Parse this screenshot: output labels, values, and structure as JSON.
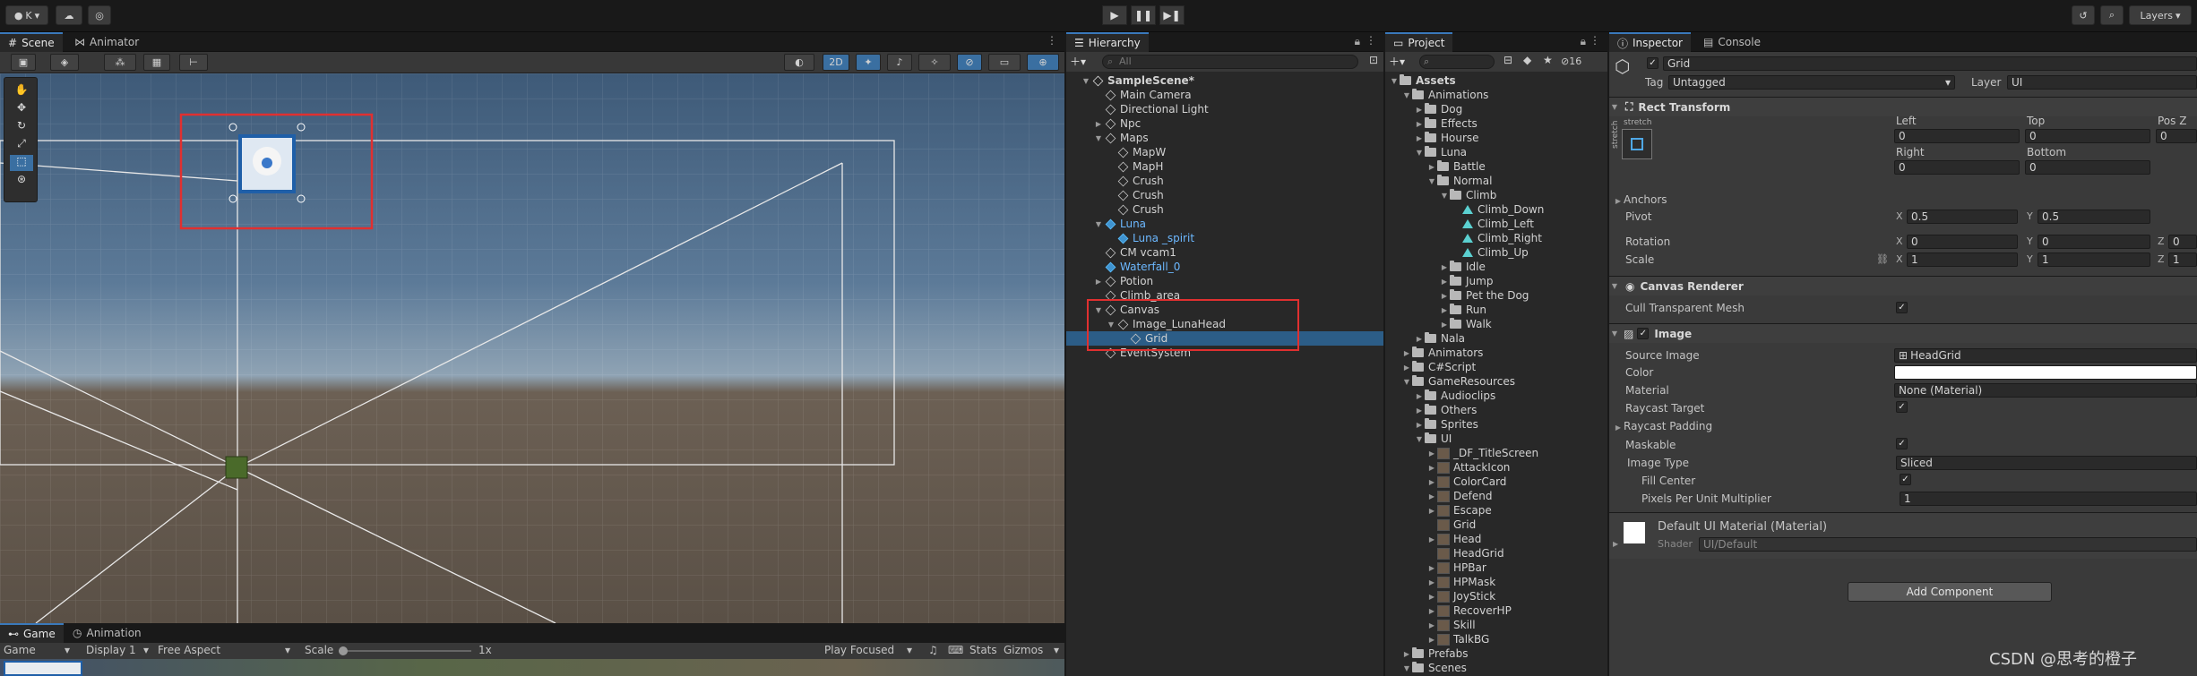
{
  "topbar": {
    "account_label": "K",
    "layers_label": "Layers",
    "play_icon": "play-icon",
    "pause_icon": "pause-icon",
    "step_icon": "step-icon"
  },
  "scene_panel": {
    "tabs": [
      {
        "label": "Scene"
      },
      {
        "label": "Animator"
      }
    ],
    "mode_2d": "2D"
  },
  "game_panel": {
    "tabs": [
      {
        "label": "Game"
      },
      {
        "label": "Animation"
      }
    ],
    "game_dropdown": "Game",
    "display_dropdown": "Display 1",
    "aspect_dropdown": "Free Aspect",
    "scale_label": "Scale",
    "scale_value": "1x",
    "play_focused": "Play Focused",
    "stats_label": "Stats",
    "gizmos_label": "Gizmos"
  },
  "hierarchy": {
    "tab_label": "Hierarchy",
    "search_placeholder": "All",
    "rows": [
      {
        "label": "SampleScene*",
        "indent": 0,
        "arrow": "▼",
        "icon": "scene",
        "bold": true
      },
      {
        "label": "Main Camera",
        "indent": 1,
        "arrow": "",
        "icon": "cube"
      },
      {
        "label": "Directional Light",
        "indent": 1,
        "arrow": "",
        "icon": "cube"
      },
      {
        "label": "Npc",
        "indent": 1,
        "arrow": "▶",
        "icon": "cube"
      },
      {
        "label": "Maps",
        "indent": 1,
        "arrow": "▼",
        "icon": "cube"
      },
      {
        "label": "MapW",
        "indent": 2,
        "arrow": "",
        "icon": "cube"
      },
      {
        "label": "MapH",
        "indent": 2,
        "arrow": "",
        "icon": "cube"
      },
      {
        "label": "Crush",
        "indent": 2,
        "arrow": "",
        "icon": "cube"
      },
      {
        "label": "Crush",
        "indent": 2,
        "arrow": "",
        "icon": "cube"
      },
      {
        "label": "Crush",
        "indent": 2,
        "arrow": "",
        "icon": "cube"
      },
      {
        "label": "Luna",
        "indent": 1,
        "arrow": "▼",
        "icon": "prefab",
        "blue": true
      },
      {
        "label": "Luna _spirit",
        "indent": 2,
        "arrow": "",
        "icon": "prefab",
        "blue": true
      },
      {
        "label": "CM vcam1",
        "indent": 1,
        "arrow": "",
        "icon": "cube"
      },
      {
        "label": "Waterfall_0",
        "indent": 1,
        "arrow": "",
        "icon": "prefab",
        "blue": true
      },
      {
        "label": "Potion",
        "indent": 1,
        "arrow": "▶",
        "icon": "cube"
      },
      {
        "label": "Climb_area",
        "indent": 1,
        "arrow": "",
        "icon": "cube"
      },
      {
        "label": "Canvas",
        "indent": 1,
        "arrow": "▼",
        "icon": "cube"
      },
      {
        "label": "Image_LunaHead",
        "indent": 2,
        "arrow": "▼",
        "icon": "cube"
      },
      {
        "label": "Grid",
        "indent": 3,
        "arrow": "",
        "icon": "cube",
        "selected": true
      },
      {
        "label": "EventSystem",
        "indent": 1,
        "arrow": "",
        "icon": "cube"
      }
    ]
  },
  "project": {
    "tab_label": "Project",
    "badge_count": "16",
    "rows": [
      {
        "label": "Assets",
        "indent": 0,
        "arrow": "▼",
        "icon": "folder",
        "bold": true
      },
      {
        "label": "Animations",
        "indent": 1,
        "arrow": "▼",
        "icon": "folder"
      },
      {
        "label": "Dog",
        "indent": 2,
        "arrow": "▶",
        "icon": "folder"
      },
      {
        "label": "Effects",
        "indent": 2,
        "arrow": "▶",
        "icon": "folder"
      },
      {
        "label": "Hourse",
        "indent": 2,
        "arrow": "▶",
        "icon": "folder"
      },
      {
        "label": "Luna",
        "indent": 2,
        "arrow": "▼",
        "icon": "folder"
      },
      {
        "label": "Battle",
        "indent": 3,
        "arrow": "▶",
        "icon": "folder"
      },
      {
        "label": "Normal",
        "indent": 3,
        "arrow": "▼",
        "icon": "folder"
      },
      {
        "label": "Climb",
        "indent": 4,
        "arrow": "▼",
        "icon": "folder"
      },
      {
        "label": "Climb_Down",
        "indent": 5,
        "arrow": "",
        "icon": "anim"
      },
      {
        "label": "Climb_Left",
        "indent": 5,
        "arrow": "",
        "icon": "anim"
      },
      {
        "label": "Climb_Right",
        "indent": 5,
        "arrow": "",
        "icon": "anim"
      },
      {
        "label": "Climb_Up",
        "indent": 5,
        "arrow": "",
        "icon": "anim"
      },
      {
        "label": "Idle",
        "indent": 4,
        "arrow": "▶",
        "icon": "folder"
      },
      {
        "label": "Jump",
        "indent": 4,
        "arrow": "▶",
        "icon": "folder"
      },
      {
        "label": "Pet the Dog",
        "indent": 4,
        "arrow": "▶",
        "icon": "folder"
      },
      {
        "label": "Run",
        "indent": 4,
        "arrow": "▶",
        "icon": "folder"
      },
      {
        "label": "Walk",
        "indent": 4,
        "arrow": "▶",
        "icon": "folder"
      },
      {
        "label": "Nala",
        "indent": 2,
        "arrow": "▶",
        "icon": "folder"
      },
      {
        "label": "Animators",
        "indent": 1,
        "arrow": "▶",
        "icon": "folder"
      },
      {
        "label": "C#Script",
        "indent": 1,
        "arrow": "▶",
        "icon": "folder"
      },
      {
        "label": "GameResources",
        "indent": 1,
        "arrow": "▼",
        "icon": "folder"
      },
      {
        "label": "Audioclips",
        "indent": 2,
        "arrow": "▶",
        "icon": "folder"
      },
      {
        "label": "Others",
        "indent": 2,
        "arrow": "▶",
        "icon": "folder"
      },
      {
        "label": "Sprites",
        "indent": 2,
        "arrow": "▶",
        "icon": "folder"
      },
      {
        "label": "UI",
        "indent": 2,
        "arrow": "▼",
        "icon": "folder"
      },
      {
        "label": "_DF_TitleScreen",
        "indent": 3,
        "arrow": "▶",
        "icon": "thumb"
      },
      {
        "label": "AttackIcon",
        "indent": 3,
        "arrow": "▶",
        "icon": "thumb"
      },
      {
        "label": "ColorCard",
        "indent": 3,
        "arrow": "▶",
        "icon": "thumb"
      },
      {
        "label": "Defend",
        "indent": 3,
        "arrow": "▶",
        "icon": "thumb"
      },
      {
        "label": "Escape",
        "indent": 3,
        "arrow": "▶",
        "icon": "thumb"
      },
      {
        "label": "Grid",
        "indent": 3,
        "arrow": "",
        "icon": "thumb"
      },
      {
        "label": "Head",
        "indent": 3,
        "arrow": "▶",
        "icon": "thumb"
      },
      {
        "label": "HeadGrid",
        "indent": 3,
        "arrow": "",
        "icon": "thumb"
      },
      {
        "label": "HPBar",
        "indent": 3,
        "arrow": "▶",
        "icon": "thumb"
      },
      {
        "label": "HPMask",
        "indent": 3,
        "arrow": "▶",
        "icon": "thumb"
      },
      {
        "label": "JoyStick",
        "indent": 3,
        "arrow": "▶",
        "icon": "thumb"
      },
      {
        "label": "RecoverHP",
        "indent": 3,
        "arrow": "▶",
        "icon": "thumb"
      },
      {
        "label": "Skill",
        "indent": 3,
        "arrow": "▶",
        "icon": "thumb"
      },
      {
        "label": "TalkBG",
        "indent": 3,
        "arrow": "▶",
        "icon": "thumb"
      },
      {
        "label": "Prefabs",
        "indent": 1,
        "arrow": "▶",
        "icon": "folder"
      },
      {
        "label": "Scenes",
        "indent": 1,
        "arrow": "▼",
        "icon": "folder"
      }
    ]
  },
  "inspector": {
    "tabs": [
      {
        "label": "Inspector"
      },
      {
        "label": "Console"
      }
    ],
    "object_name": "Grid",
    "tag_label": "Tag",
    "tag_value": "Untagged",
    "layer_label": "Layer",
    "layer_value": "UI",
    "rect_transform": {
      "title": "Rect Transform",
      "stretch_label": "stretch",
      "left_label": "Left",
      "left_value": "0",
      "top_label": "Top",
      "top_value": "0",
      "posz_label": "Pos Z",
      "posz_value": "0",
      "right_label": "Right",
      "right_value": "0",
      "bottom_label": "Bottom",
      "bottom_value": "0",
      "anchors_label": "Anchors",
      "pivot_label": "Pivot",
      "pivot_x": "0.5",
      "pivot_y": "0.5",
      "rotation_label": "Rotation",
      "rot_x": "0",
      "rot_y": "0",
      "rot_z": "0",
      "scale_label": "Scale",
      "scale_x": "1",
      "scale_y": "1",
      "scale_z": "1"
    },
    "canvas_renderer": {
      "title": "Canvas Renderer",
      "cull_label": "Cull Transparent Mesh"
    },
    "image": {
      "title": "Image",
      "source_label": "Source Image",
      "source_value": "HeadGrid",
      "color_label": "Color",
      "material_label": "Material",
      "material_value": "None (Material)",
      "raycast_label": "Raycast Target",
      "padding_label": "Raycast Padding",
      "maskable_label": "Maskable",
      "type_label": "Image Type",
      "type_value": "Sliced",
      "fill_label": "Fill Center",
      "ppu_label": "Pixels Per Unit Multiplier",
      "ppu_value": "1"
    },
    "material": {
      "title": "Default UI Material (Material)",
      "shader_label": "Shader",
      "shader_value": "UI/Default"
    },
    "add_component": "Add Component"
  },
  "watermark": "CSDN @思考的橙子"
}
